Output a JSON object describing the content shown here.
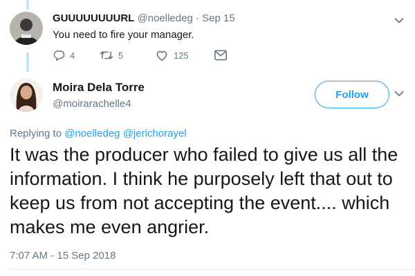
{
  "reply_tweet": {
    "name": "GUUUUUUUURL",
    "handle": "@noelledeg",
    "separator": "·",
    "date": "Sep 15",
    "text": "You need to fire your manager.",
    "counts": {
      "replies": "4",
      "retweets": "5",
      "likes": "125"
    },
    "icons": {
      "reply": "reply-icon",
      "retweet": "retweet-icon",
      "like": "heart-icon",
      "message": "envelope-icon",
      "menu": "chevron-down-icon"
    }
  },
  "main_tweet": {
    "name": "Moira Dela Torre",
    "handle": "@moirarachelle4",
    "follow_label": "Follow",
    "replying_prefix": "Replying to",
    "replying_to": [
      "@noelledeg",
      "@jerichorayel"
    ],
    "text": "It was the producer who failed to give us all the information. I think he purposely left that out to keep us from not accepting the event.... which makes me even angrier.",
    "timestamp": "7:07 AM - 15 Sep 2018"
  },
  "colors": {
    "accent": "#1da1f2",
    "thread_line": "#c4e3f5",
    "text_primary": "#14171a",
    "text_secondary": "#657786"
  }
}
